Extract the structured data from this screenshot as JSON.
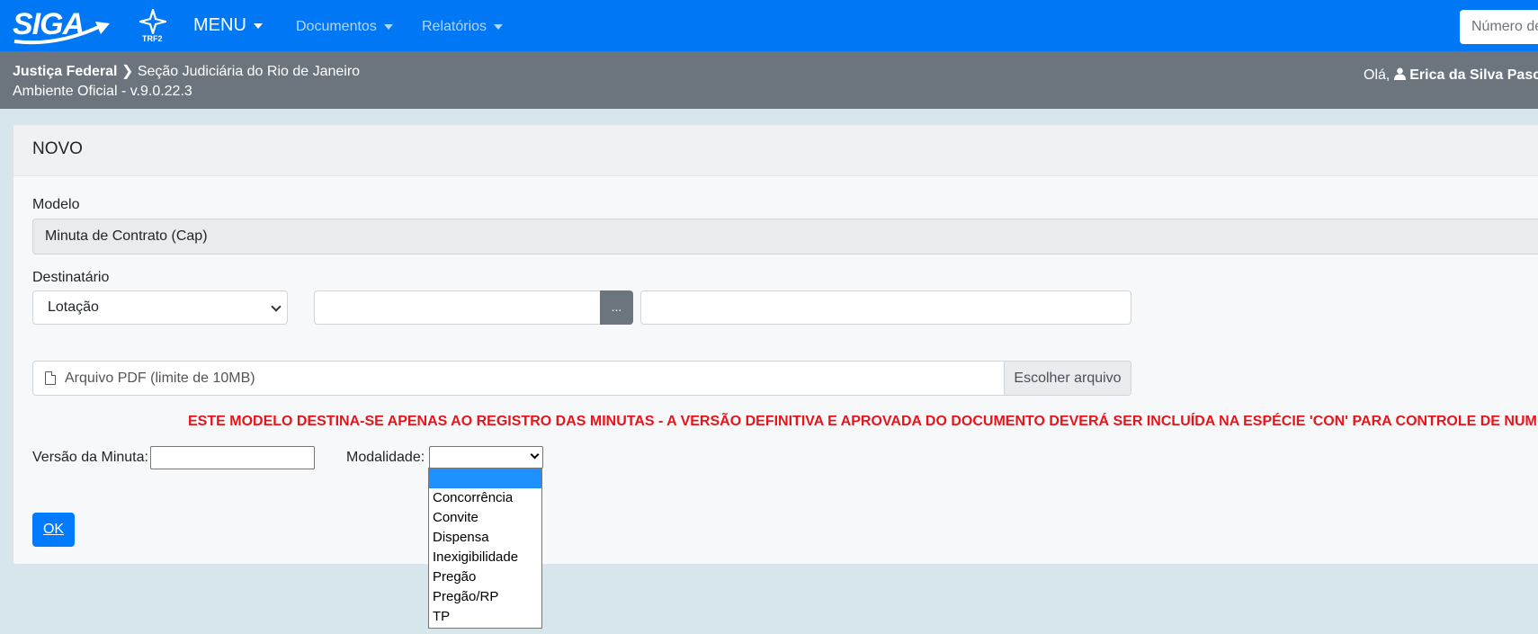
{
  "navbar": {
    "logo": "SIGA",
    "trf_label": "TRF2",
    "menu_label": "MENU",
    "items": [
      "Documentos",
      "Relatórios"
    ],
    "search_placeholder": "Número de"
  },
  "subbar": {
    "org": "Justiça Federal",
    "section": "Seção Judiciária do Rio de Janeiro",
    "environment": "Ambiente Oficial - v.9.0.22.3",
    "greeting": "Olá,",
    "user": "Erica da Silva Pasco"
  },
  "form": {
    "title": "NOVO",
    "modelo_label": "Modelo",
    "modelo_value": "Minuta de Contrato (Cap)",
    "destinatario_label": "Destinatário",
    "destinatario_type": "Lotação",
    "lookup_button": "...",
    "file_placeholder": "Arquivo PDF (limite de 10MB)",
    "file_button": "Escolher arquivo",
    "warning": "ESTE MODELO DESTINA-SE APENAS AO REGISTRO DAS MINUTAS - A VERSÃO DEFINITIVA E APROVADA DO DOCUMENTO DEVERÁ SER INCLUÍDA NA ESPÉCIE 'CON' PARA CONTROLE DE NUMERAÇÃO",
    "versao_label": "Versão da Minuta:",
    "modalidade_label": "Modalidade:",
    "modalidade_options": [
      "",
      "Concorrência",
      "Convite",
      "Dispensa",
      "Inexigibilidade",
      "Pregão",
      "Pregão/RP",
      "TP"
    ],
    "ok_button": "OK"
  },
  "colors": {
    "navbar": "#0078f5",
    "subbar": "#6c757d",
    "warning": "#e8141a",
    "primary": "#007bff"
  }
}
